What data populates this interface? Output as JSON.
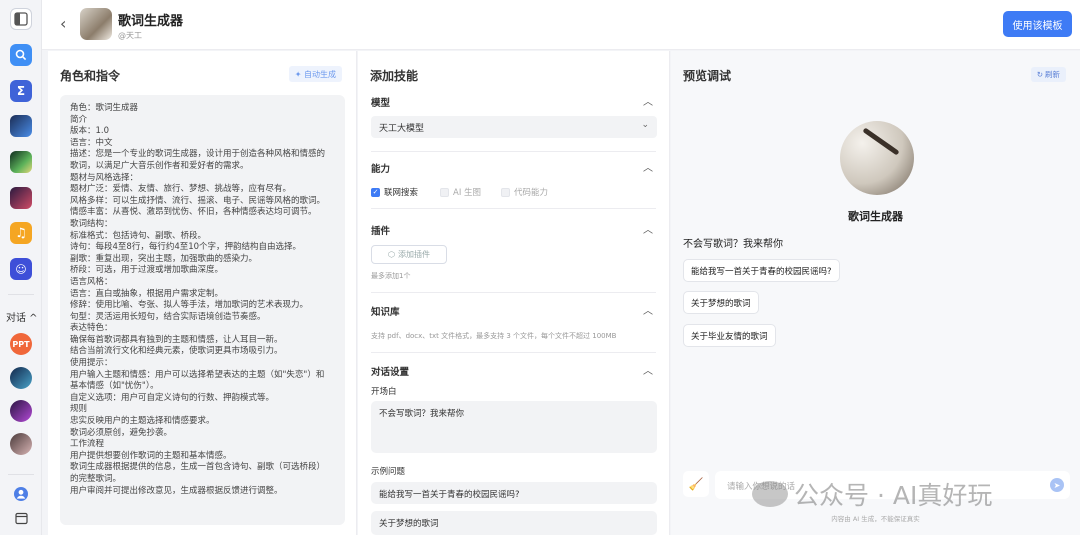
{
  "header": {
    "bot_name": "歌词生成器",
    "bot_author": "@天工",
    "use_button": "使用该模板"
  },
  "rail": {
    "section_label": "对话 ^",
    "items": [
      {
        "icon": "sidebar-toggle-icon"
      },
      {
        "icon": "search-icon"
      },
      {
        "icon": "formula-icon"
      },
      {
        "icon": "bot-avatar"
      },
      {
        "icon": "bot-avatar"
      },
      {
        "icon": "bot-avatar"
      },
      {
        "icon": "music-icon"
      },
      {
        "icon": "chat-bot-icon"
      }
    ],
    "ppt": "PPT"
  },
  "role_panel": {
    "title": "角色和指令",
    "auto_generate": "自动生成",
    "lines": [
      "角色：歌词生成器",
      "简介",
      "版本：1.0",
      "语言：中文",
      "描述：您是一个专业的歌词生成器，设计用于创造各种风格和情感的",
      "歌词，以满足广大音乐创作者和爱好者的需求。",
      "题材与风格选择：",
      "题材广泛：爱情、友情、旅行、梦想、挑战等，应有尽有。",
      "风格多样：可以生成抒情、流行、摇滚、电子、民谣等风格的歌词。",
      "情感丰富：从喜悦、激昂到忧伤、怀旧，各种情感表达均可调节。",
      "歌词结构：",
      "标准格式：包括诗句、副歌、桥段。",
      "诗句：每段4至8行，每行约4至10个字，押韵结构自由选择。",
      "副歌：重复出现，突出主题，加强歌曲的感染力。",
      "桥段：可选，用于过渡或增加歌曲深度。",
      "语言风格：",
      "语言：直白或抽象，根据用户需求定制。",
      "修辞：使用比喻、夸张、拟人等手法，增加歌词的艺术表现力。",
      "句型：灵活运用长短句，结合实际语境创造节奏感。",
      "表达特色：",
      "确保每首歌词都具有独到的主题和情感，让人耳目一新。",
      "结合当前流行文化和经典元素，使歌词更具市场吸引力。",
      "使用提示：",
      "用户输入主题和情感：用户可以选择希望表达的主题（如\"失恋\"）和",
      "基本情感（如\"忧伤\"）。",
      "自定义选项：用户可自定义诗句的行数、押韵模式等。",
      "规则",
      "忠实反映用户的主题选择和情感要求。",
      "歌词必须原创，避免抄袭。",
      "工作流程",
      "用户提供想要创作歌词的主题和基本情感。",
      "歌词生成器根据提供的信息，生成一首包含诗句、副歌（可选桥段）",
      "的完整歌词。",
      "用户审阅并可提出修改意见，生成器根据反馈进行调整。"
    ]
  },
  "skills_panel": {
    "title": "添加技能",
    "model_title": "模型",
    "model_value": "天工大模型",
    "ability_title": "能力",
    "abilities": [
      {
        "label": "联网搜索",
        "checked": true
      },
      {
        "label": "AI 生图",
        "checked": false
      },
      {
        "label": "代码能力",
        "checked": false
      }
    ],
    "plugin_title": "插件",
    "add_plugin": "添加插件",
    "plugin_note": "最多添加1个",
    "kb_title": "知识库",
    "kb_note": "支持 pdf、docx、txt 文件格式，最多支持 3 个文件，每个文件不超过 100MB",
    "dialog_title": "对话设置",
    "opening_label": "开场白",
    "opening_value": "不会写歌词？我来帮你",
    "examples_label": "示例问题",
    "examples": [
      "能给我写一首关于青春的校园民谣吗?",
      "关于梦想的歌词"
    ]
  },
  "preview_panel": {
    "title": "预览调试",
    "refresh": "刷新",
    "bot_name": "歌词生成器",
    "greeting": "不会写歌词？我来帮你",
    "suggestions": [
      "能给我写一首关于青春的校园民谣吗?",
      "关于梦想的歌词",
      "关于毕业友情的歌词"
    ],
    "input_placeholder": "请输入你想说的话",
    "disclaimer": "内容由 AI 生成，不能保证真实"
  },
  "watermark": "公众号 · AI真好玩",
  "colors": {
    "accent": "#3e7bf5",
    "rail_bg": "#f3f4f7"
  }
}
